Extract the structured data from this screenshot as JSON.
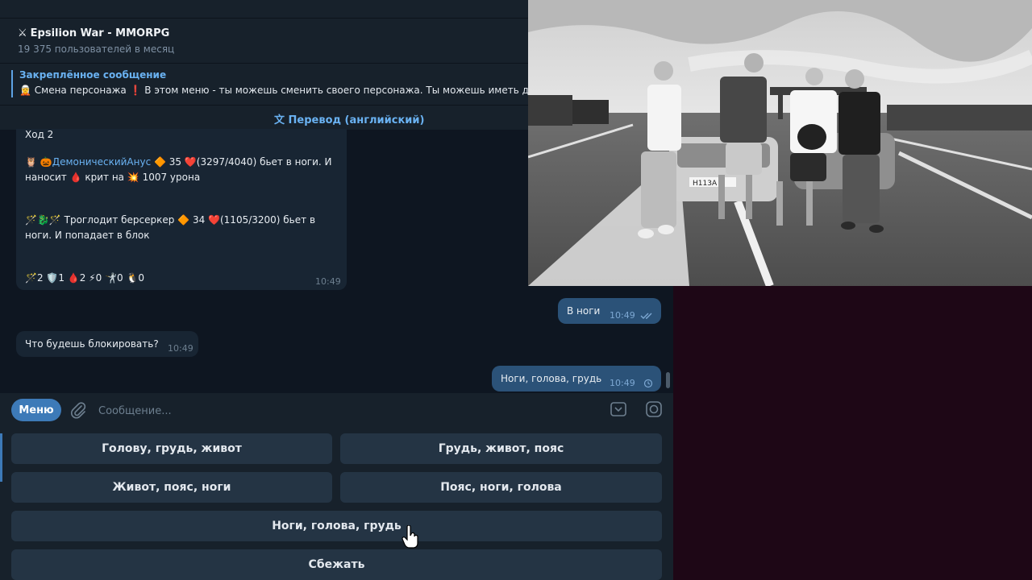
{
  "window": {
    "title": "Epsilion War - MMORPG",
    "subtitle": "19 375 пользователей в месяц"
  },
  "pinned": {
    "title": "Закреплённое сообщение",
    "text": "🧝 Смена персонажа ❗ В этом меню - ты можешь сменить своего персонажа. Ты можешь иметь д"
  },
  "translate": {
    "label": "Перевод (английский)",
    "icon": "translate-icon"
  },
  "messages": {
    "bot_turn": {
      "line1": "Ход 2",
      "line2_prefix": "🦉 🎃",
      "line2_name": "ДемоническийАнус",
      "line2_rest": " 🔶 35 ❤️(3297/4040) бьет в ноги.  И",
      "line3": "наносит 🩸 крит на 💥 1007 урона",
      "line4": "🪄🐉🪄 Троглодит берсеркер 🔶 34 ❤️(1105/3200) бьет в",
      "line5": "ноги. И попадает в блок",
      "line6": "🪄2 🛡️1 🩸2 ⚡0 🤺0 🐧0",
      "time": "10:49"
    },
    "out1": {
      "text": "В ноги",
      "time": "10:49",
      "status": "read"
    },
    "in2": {
      "text": "Что будешь блокировать?",
      "time": "10:49"
    },
    "out2": {
      "text": "Ноги, голова, грудь",
      "time": "10:49",
      "status": "pending"
    }
  },
  "composer": {
    "menu_label": "Меню",
    "placeholder": "Сообщение..."
  },
  "keyboard": {
    "b1": "Голову, грудь, живот",
    "b2": "Грудь, живот, пояс",
    "b3": "Живот, пояс, ноги",
    "b4": "Пояс, ноги, голова",
    "b5": "Ноги, голова, грудь",
    "b6": "Сбежать"
  },
  "video": {
    "plate": "Н113А"
  },
  "colors": {
    "accent": "#6ab2f2",
    "bubble_out": "#2b5278",
    "bubble_in": "#182533",
    "background": "#0e1621",
    "right_panel": "#1e0716"
  }
}
